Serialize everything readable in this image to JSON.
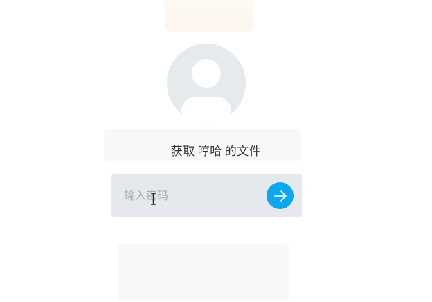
{
  "title": {
    "prefix": "获取",
    "user": "哼哈",
    "suffix": "的文件"
  },
  "password": {
    "placeholder": "输入密码",
    "value": ""
  },
  "icons": {
    "avatar": "user-avatar-icon",
    "submit": "arrow-right-icon",
    "cursor": "text-cursor-icon"
  },
  "colors": {
    "accent": "#0aa8f0",
    "input_bg": "#e5e8ec",
    "avatar_bg": "#e7eaed"
  }
}
